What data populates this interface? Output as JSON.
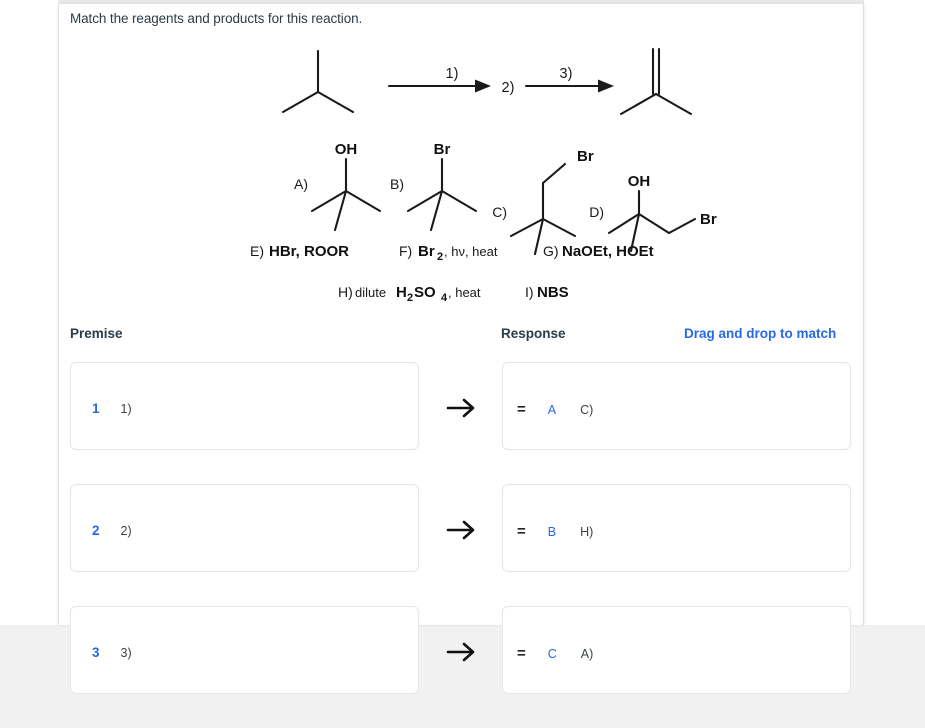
{
  "prompt": "Match the reagents and products for this reaction.",
  "colors": {
    "accent_blue": "#2569e8",
    "text_dark": "#2d3b45",
    "box_border": "#e4e6e8",
    "page_bg": "#f5f5f5"
  },
  "scheme": {
    "reactant_name": "isobutane",
    "product_name": "2-methylpropene",
    "arrow_labels": [
      "1)",
      "2)",
      "3)"
    ],
    "step_labels": {
      "first": "1)",
      "intermediate": "2)",
      "third": "3)"
    }
  },
  "choices": {
    "structures": [
      {
        "key": "A)",
        "label": "A)",
        "substituent": "OH",
        "structure": "tert-butanol"
      },
      {
        "key": "B)",
        "label": "B)",
        "substituent": "Br",
        "structure": "tert-butyl bromide"
      },
      {
        "key": "C)",
        "label": "C)",
        "substituent": "Br",
        "structure": "isobutyl bromide"
      },
      {
        "key": "D)",
        "label": "D)",
        "substituent": "OH",
        "substituent2": "Br",
        "structure": "1-bromo-2-methyl-2-propanol"
      }
    ],
    "reagents": [
      {
        "key": "E)",
        "label": "E)",
        "text": "HBr, ROOR"
      },
      {
        "key": "F)",
        "label": "F)",
        "text": "Br",
        "sub": "2",
        "text_after": ", hν, heat"
      },
      {
        "key": "G)",
        "label": "G)",
        "text": "NaOEt, HOEt"
      },
      {
        "key": "H)",
        "label": "H)",
        "prefix": "dilute ",
        "text": "H",
        "sub": "2",
        "text_mid": "SO",
        "sub2": "4",
        "text_after": ", heat"
      },
      {
        "key": "I)",
        "label": "I)",
        "text": "NBS"
      }
    ]
  },
  "match": {
    "header_premise": "Premise",
    "header_response": "Response",
    "header_drag": "Drag and drop to match",
    "rows": [
      {
        "index": "1",
        "premise_label": "1)",
        "eq": "=",
        "letter": "A",
        "response_label": "C)"
      },
      {
        "index": "2",
        "premise_label": "2)",
        "eq": "=",
        "letter": "B",
        "response_label": "H)"
      },
      {
        "index": "3",
        "premise_label": "3)",
        "eq": "=",
        "letter": "C",
        "response_label": "A)"
      }
    ]
  }
}
